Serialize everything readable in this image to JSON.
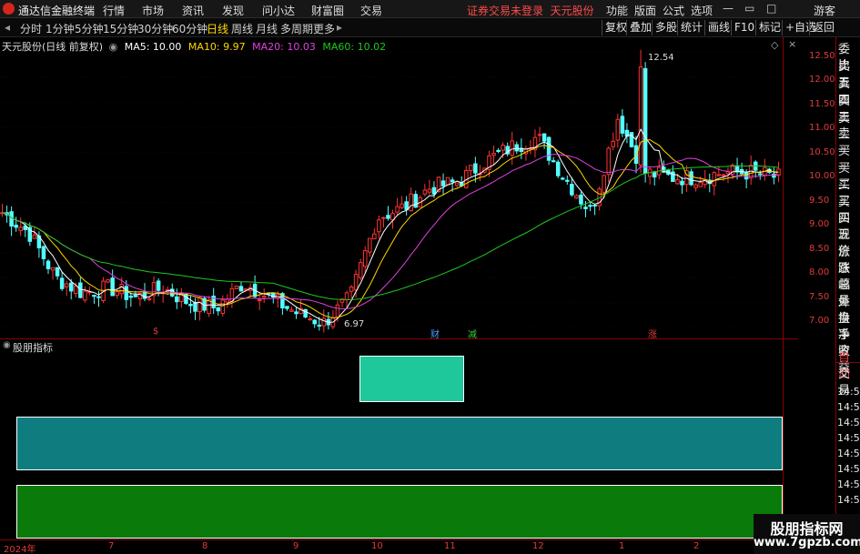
{
  "app": {
    "name": "通达信金融终端",
    "login_status": "证券交易未登录",
    "stock": "天元股份"
  },
  "menu": [
    "行情",
    "市场",
    "资讯",
    "发现",
    "问小达",
    "财富圈",
    "交易"
  ],
  "right_menu": [
    "功能",
    "版面",
    "公式",
    "选项",
    "游客"
  ],
  "toolbar": {
    "periods": [
      "分时",
      "1分钟",
      "5分钟",
      "15分钟",
      "30分钟",
      "60分钟",
      "日线",
      "周线",
      "月线",
      "多周期",
      "更多"
    ],
    "selected": "日线",
    "right_buttons": [
      "复权",
      "叠加",
      "多股",
      "统计",
      "画线",
      "F10",
      "标记",
      "+自选",
      "返回"
    ]
  },
  "chart": {
    "title": "天元股份(日线 前复权)",
    "ma": [
      {
        "label": "MA5: 10.00",
        "color": "#ffffff"
      },
      {
        "label": "MA10: 9.97",
        "color": "#ffd700"
      },
      {
        "label": "MA20: 10.03",
        "color": "#e040e0"
      },
      {
        "label": "MA60: 10.02",
        "color": "#1ec81e"
      }
    ],
    "yticks": [
      "12.50",
      "12.00",
      "11.50",
      "11.00",
      "10.50",
      "10.00",
      "9.50",
      "9.00",
      "8.50",
      "8.00",
      "7.50",
      "7.00"
    ],
    "high_label": "12.54",
    "low_label": "6.97",
    "markers": [
      {
        "text": "$",
        "color": "#e03a3a"
      },
      {
        "text": "财",
        "color": "#4aa0ff"
      },
      {
        "text": "减",
        "color": "#30d030"
      },
      {
        "text": "涨",
        "color": "#e03a3a"
      }
    ]
  },
  "sub": {
    "title": "股朋指标",
    "colors": {
      "block1": "#1ec89a",
      "block2": "#0f7d80",
      "block3": "#0a7a0a"
    }
  },
  "info_panel": [
    "委比",
    "卖五",
    "卖四",
    "卖三",
    "卖二",
    "卖一",
    "买一",
    "买二",
    "买三",
    "买四",
    "买五",
    "现价",
    "涨跌",
    "涨幅",
    "总量",
    "外盘",
    "换手",
    "净资",
    "收益"
  ],
  "trade_panel": [
    "自动",
    "交易"
  ],
  "times": [
    "14:56",
    "14:56",
    "14:56",
    "14:56",
    "14:56",
    "14:56",
    "14:56",
    "14:56"
  ],
  "xticks": [
    "2024年",
    "7",
    "8",
    "9",
    "10",
    "11",
    "12",
    "1",
    "2"
  ],
  "watermark": {
    "line1": "股朋指标网",
    "line2": "www.7gpzb.com"
  },
  "chart_data": {
    "type": "candlestick",
    "ylim": [
      6.9,
      12.7
    ],
    "x_labels": [
      "2024年",
      "7",
      "8",
      "9",
      "10",
      "11",
      "12",
      "1",
      "2"
    ],
    "close_trend": [
      9.3,
      8.9,
      8.0,
      7.7,
      7.8,
      7.6,
      7.8,
      7.5,
      7.4,
      7.9,
      7.6,
      7.3,
      7.1,
      7.6,
      9.2,
      9.4,
      9.8,
      9.9,
      10.3,
      10.6,
      10.8,
      10.0,
      9.3,
      11.2,
      10.1,
      10.0,
      10.0,
      10.1,
      10.1,
      10.0
    ],
    "high": 12.54,
    "low": 6.97,
    "ma5": 10.0,
    "ma10": 9.97,
    "ma20": 10.03,
    "ma60": 10.02
  }
}
